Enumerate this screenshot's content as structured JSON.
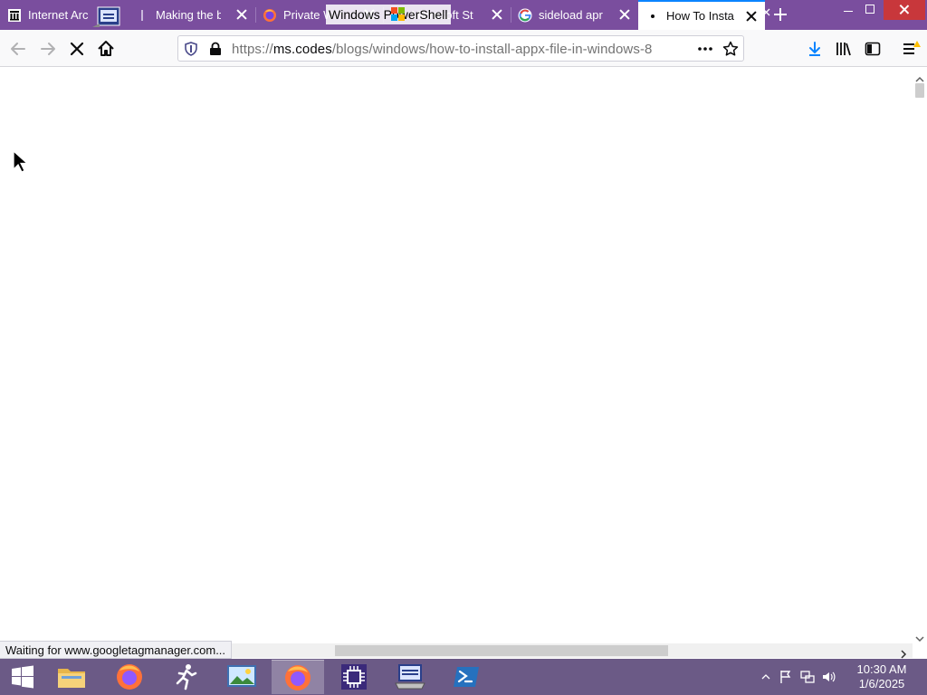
{
  "tabs": [
    {
      "title": "Internet Arc",
      "icon": "archive-icon"
    },
    {
      "title": "Making the b",
      "icon": "page-icon"
    },
    {
      "title": "Private Win",
      "icon": "firefox-icon"
    },
    {
      "title": "Microsoft St",
      "icon": "microsoft-store-icon"
    },
    {
      "title": "sideload apr",
      "icon": "google-icon"
    },
    {
      "title": "How To Insta",
      "icon": "loading-dot-icon",
      "active": true
    }
  ],
  "overlay_window_title": "Windows PowerShell",
  "urlbar": {
    "scheme": "https://",
    "host": "ms.codes",
    "path": "/blogs/windows/how-to-install-appx-file-in-windows-8"
  },
  "status_text": "Waiting for www.googletagmanager.com...",
  "taskbar": {
    "items": [
      {
        "name": "start-button"
      },
      {
        "name": "file-explorer"
      },
      {
        "name": "firefox"
      },
      {
        "name": "runner-app"
      },
      {
        "name": "photos-app"
      },
      {
        "name": "firefox-active",
        "active": true
      },
      {
        "name": "chip-app"
      },
      {
        "name": "remote-desktop-app"
      },
      {
        "name": "powershell-app"
      }
    ],
    "clock_time": "10:30 AM",
    "clock_date": "1/6/2025"
  },
  "colors": {
    "tabstrip": "#7a4e9e",
    "accent": "#0a84ff",
    "taskbar": "#6b5a86"
  }
}
